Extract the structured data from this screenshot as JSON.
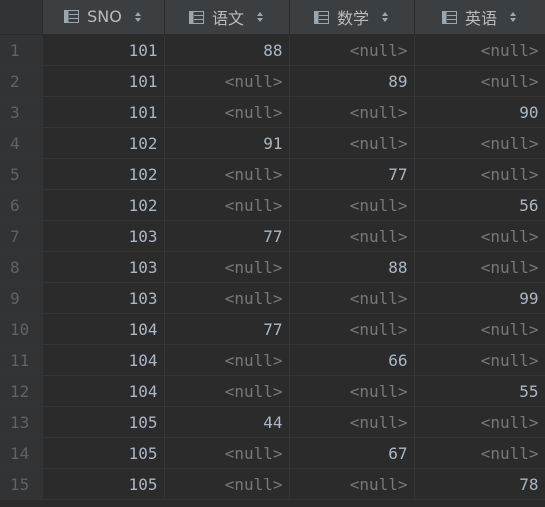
{
  "columns": [
    {
      "label": "",
      "key": "rownum"
    },
    {
      "label": "SNO",
      "key": "sno"
    },
    {
      "label": "语文",
      "key": "yuwen"
    },
    {
      "label": "数学",
      "key": "shuxue"
    },
    {
      "label": "英语",
      "key": "yingyu"
    }
  ],
  "null_text": "<null>",
  "rows": [
    {
      "n": "1",
      "sno": "101",
      "yuwen": "88",
      "shuxue": "<null>",
      "yingyu": "<null>"
    },
    {
      "n": "2",
      "sno": "101",
      "yuwen": "<null>",
      "shuxue": "89",
      "yingyu": "<null>"
    },
    {
      "n": "3",
      "sno": "101",
      "yuwen": "<null>",
      "shuxue": "<null>",
      "yingyu": "90"
    },
    {
      "n": "4",
      "sno": "102",
      "yuwen": "91",
      "shuxue": "<null>",
      "yingyu": "<null>"
    },
    {
      "n": "5",
      "sno": "102",
      "yuwen": "<null>",
      "shuxue": "77",
      "yingyu": "<null>"
    },
    {
      "n": "6",
      "sno": "102",
      "yuwen": "<null>",
      "shuxue": "<null>",
      "yingyu": "56"
    },
    {
      "n": "7",
      "sno": "103",
      "yuwen": "77",
      "shuxue": "<null>",
      "yingyu": "<null>"
    },
    {
      "n": "8",
      "sno": "103",
      "yuwen": "<null>",
      "shuxue": "88",
      "yingyu": "<null>"
    },
    {
      "n": "9",
      "sno": "103",
      "yuwen": "<null>",
      "shuxue": "<null>",
      "yingyu": "99"
    },
    {
      "n": "10",
      "sno": "104",
      "yuwen": "77",
      "shuxue": "<null>",
      "yingyu": "<null>"
    },
    {
      "n": "11",
      "sno": "104",
      "yuwen": "<null>",
      "shuxue": "66",
      "yingyu": "<null>"
    },
    {
      "n": "12",
      "sno": "104",
      "yuwen": "<null>",
      "shuxue": "<null>",
      "yingyu": "55"
    },
    {
      "n": "13",
      "sno": "105",
      "yuwen": "44",
      "shuxue": "<null>",
      "yingyu": "<null>"
    },
    {
      "n": "14",
      "sno": "105",
      "yuwen": "<null>",
      "shuxue": "67",
      "yingyu": "<null>"
    },
    {
      "n": "15",
      "sno": "105",
      "yuwen": "<null>",
      "shuxue": "<null>",
      "yingyu": "78"
    }
  ],
  "icons": {
    "column_icon": "table-column-icon",
    "sort_icon": "sort-arrows-icon"
  },
  "colors": {
    "background": "#2b2b2b",
    "header_background": "#3c3f41",
    "text": "#a9b7c6",
    "null_text": "#787878",
    "row_number": "#606366"
  }
}
